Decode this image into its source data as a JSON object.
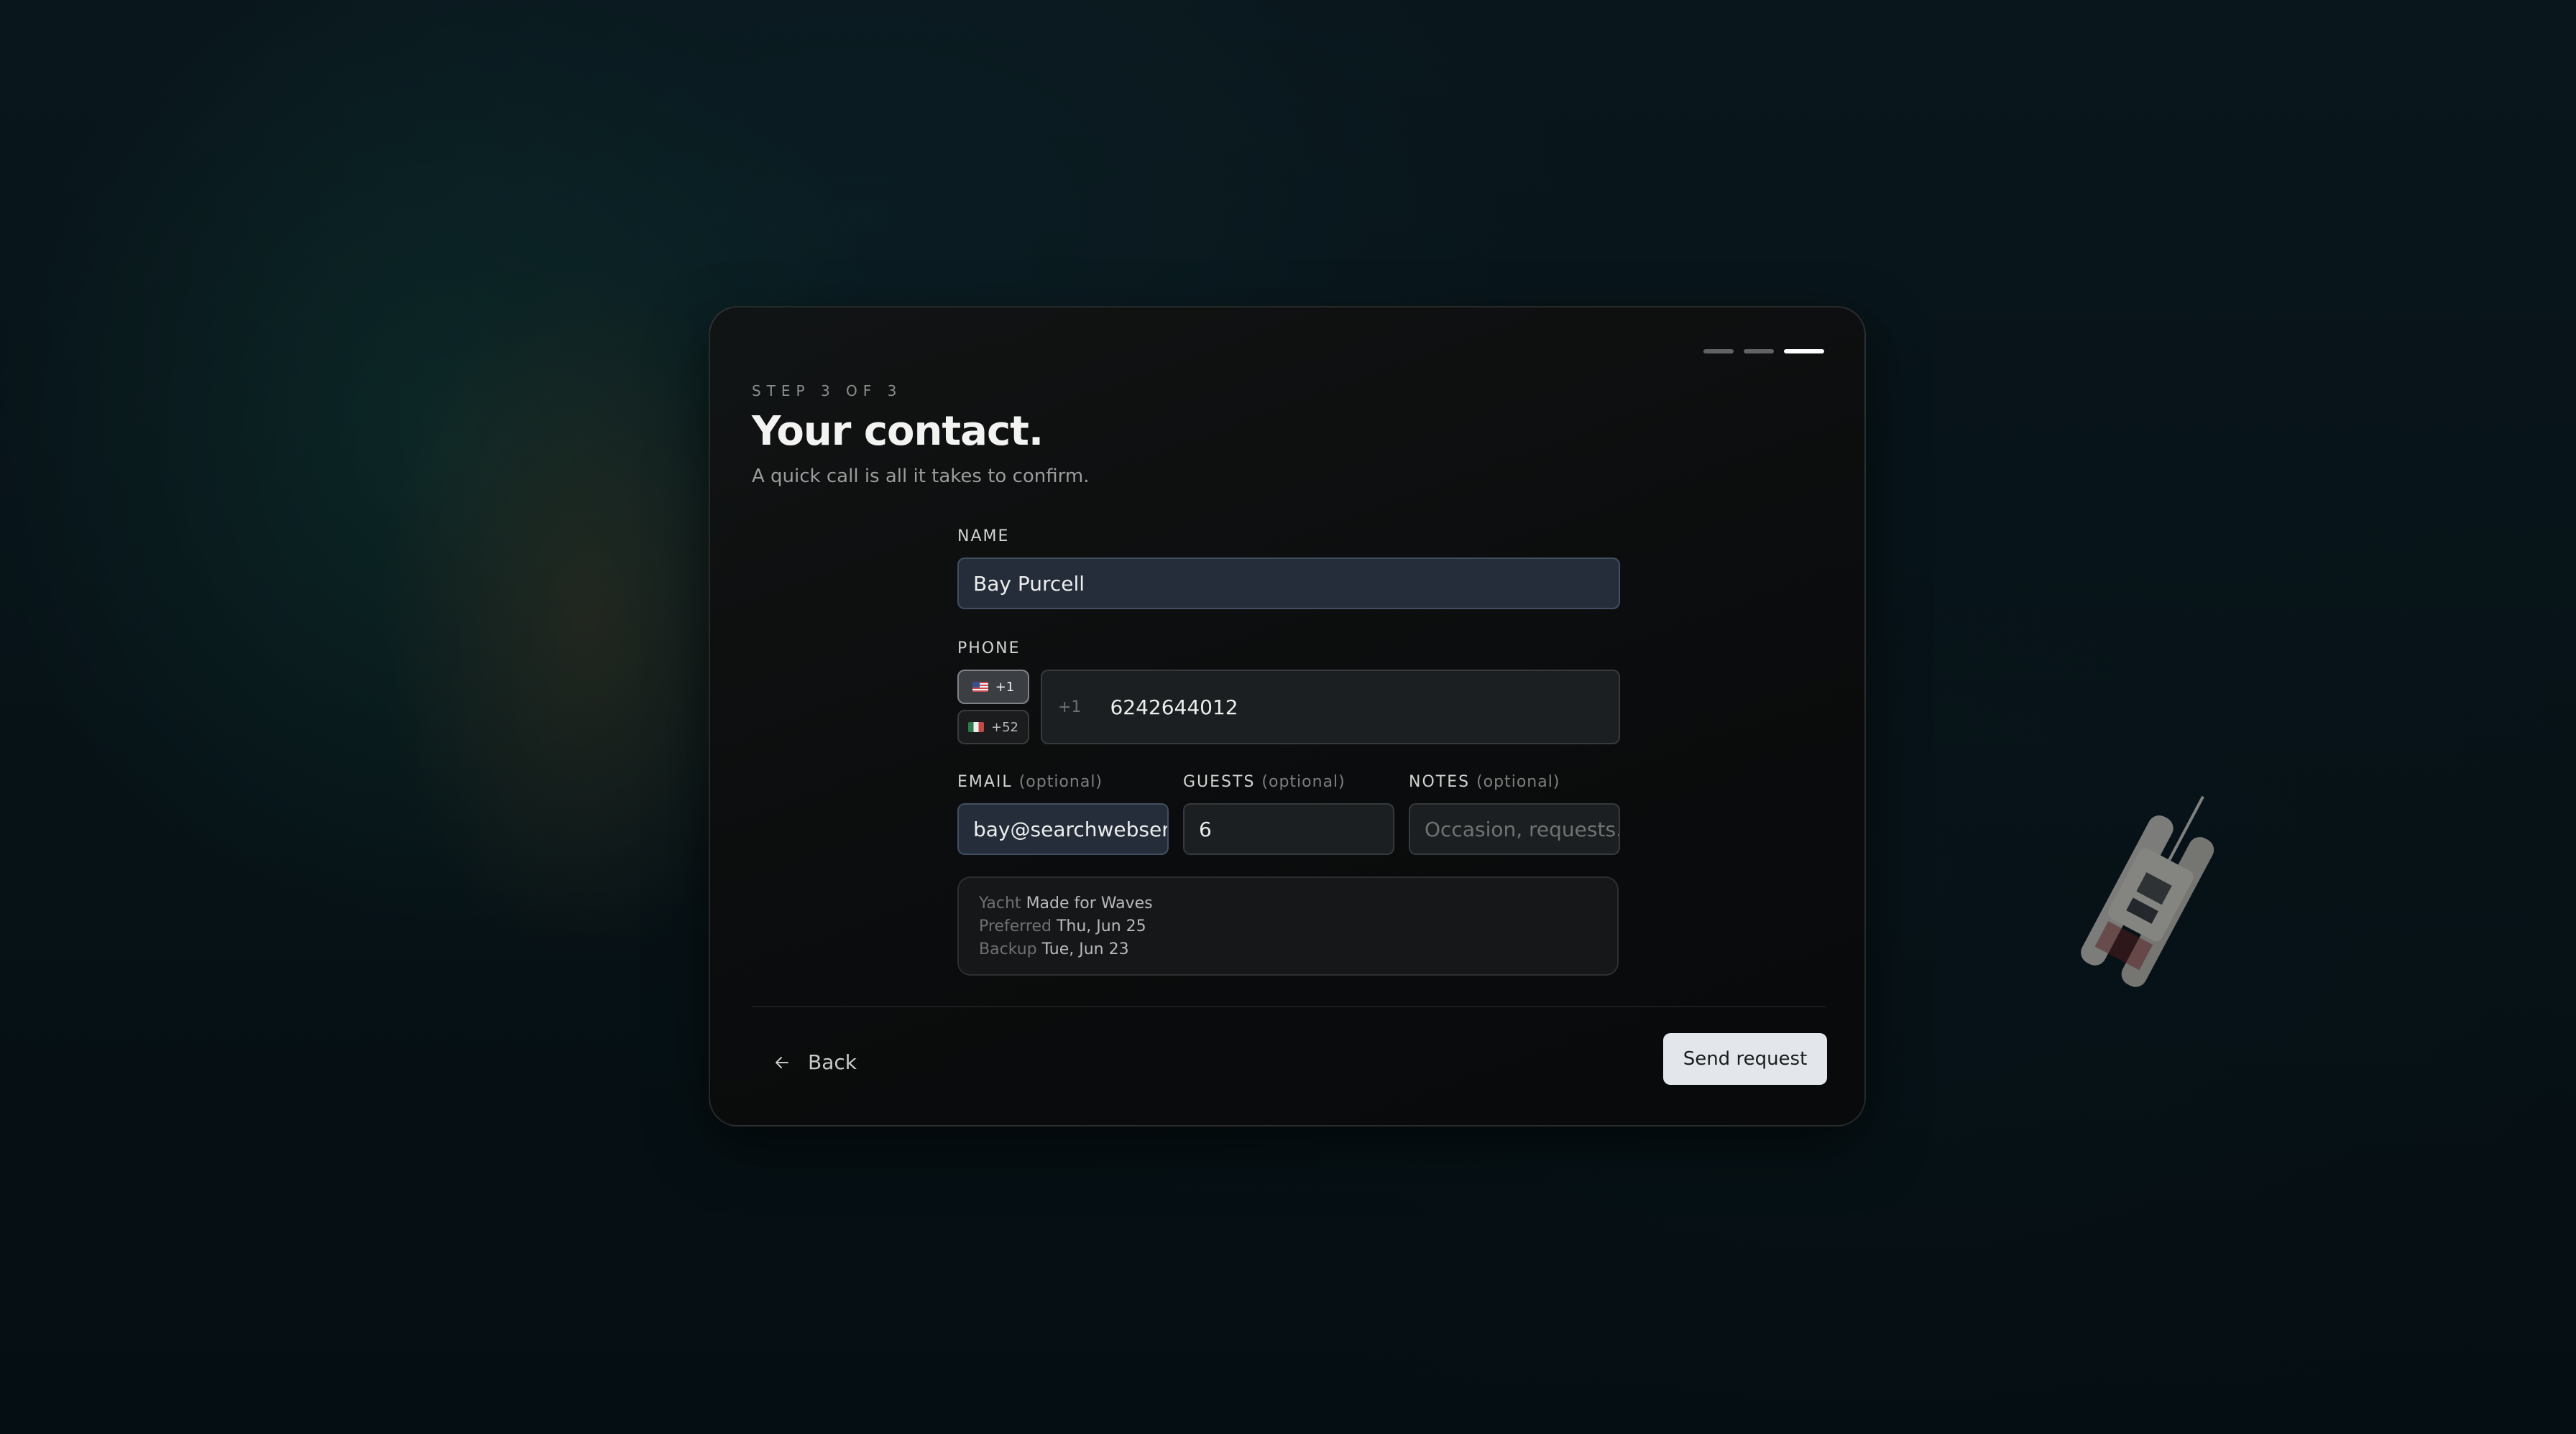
{
  "progress": {
    "total_steps": 3,
    "current_step": 3
  },
  "header": {
    "step": "STEP 3 OF 3",
    "title": "Your contact.",
    "subtitle": "A quick call is all it takes to confirm."
  },
  "form": {
    "name": {
      "label": "NAME",
      "value": "Bay Purcell"
    },
    "phone": {
      "label": "PHONE",
      "country_codes": [
        {
          "code": "+1",
          "flag": "us-flag-icon",
          "selected": true
        },
        {
          "code": "+52",
          "flag": "mx-flag-icon",
          "selected": false
        }
      ],
      "prefix": "+1",
      "value": "6242644012"
    },
    "email": {
      "label": "EMAIL",
      "optional": "(optional)",
      "value": "bay@searchwebser"
    },
    "guests": {
      "label": "GUESTS",
      "optional": "(optional)",
      "value": "6"
    },
    "notes": {
      "label": "NOTES",
      "optional": "(optional)",
      "placeholder": "Occasion, requests..."
    }
  },
  "summary": {
    "yacht_label": "Yacht",
    "yacht_value": "Made for Waves",
    "preferred_label": "Preferred",
    "preferred_value": "Thu, Jun 25",
    "backup_label": "Backup",
    "backup_value": "Tue, Jun 23"
  },
  "actions": {
    "back_label": "Back",
    "back_icon": "arrow-left-icon",
    "send_label": "Send request"
  },
  "colors": {
    "card_bg": "#0c0e0f",
    "filled_field_bg": "#252d3a",
    "primary_button_bg": "#e3e6ea",
    "active_progress": "#ffffff"
  }
}
